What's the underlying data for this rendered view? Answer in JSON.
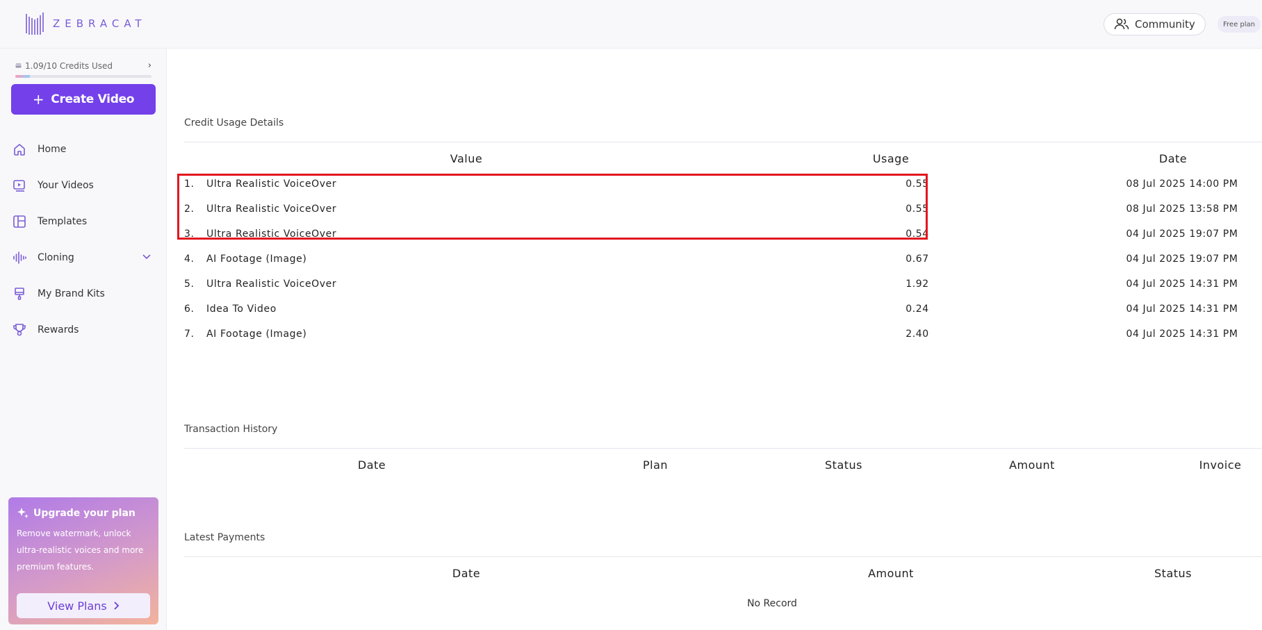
{
  "brand": {
    "name": "ZEBRACAT"
  },
  "header": {
    "community_label": "Community",
    "plan_badge": "Free plan"
  },
  "sidebar": {
    "credits_label": "1.09/10 Credits Used",
    "credits_progress": 0.109,
    "create_label": "Create Video",
    "items": [
      {
        "label": "Home",
        "icon": "home-icon"
      },
      {
        "label": "Your Videos",
        "icon": "video-play-icon"
      },
      {
        "label": "Templates",
        "icon": "templates-icon"
      },
      {
        "label": "Cloning",
        "icon": "waveform-icon"
      },
      {
        "label": "My Brand Kits",
        "icon": "brush-icon"
      },
      {
        "label": "Rewards",
        "icon": "trophy-icon"
      }
    ],
    "upgrade": {
      "title": "Upgrade your plan",
      "description": "Remove watermark, unlock ultra-realistic voices and more premium features.",
      "button": "View Plans"
    }
  },
  "credit_usage": {
    "title": "Credit Usage Details",
    "headers": [
      "Value",
      "Usage",
      "Date"
    ],
    "rows": [
      {
        "num": "1.",
        "value": "Ultra Realistic VoiceOver",
        "usage": "0.55",
        "date": "08 Jul 2025 14:00 PM"
      },
      {
        "num": "2.",
        "value": "Ultra Realistic VoiceOver",
        "usage": "0.55",
        "date": "08 Jul 2025 13:58 PM"
      },
      {
        "num": "3.",
        "value": "Ultra Realistic VoiceOver",
        "usage": "0.54",
        "date": "04 Jul 2025 19:07 PM"
      },
      {
        "num": "4.",
        "value": "AI Footage (Image)",
        "usage": "0.67",
        "date": "04 Jul 2025 19:07 PM"
      },
      {
        "num": "5.",
        "value": "Ultra Realistic VoiceOver",
        "usage": "1.92",
        "date": "04 Jul 2025 14:31 PM"
      },
      {
        "num": "6.",
        "value": "Idea To Video",
        "usage": "0.24",
        "date": "04 Jul 2025 14:31 PM"
      },
      {
        "num": "7.",
        "value": "AI Footage (Image)",
        "usage": "2.40",
        "date": "04 Jul 2025 14:31 PM"
      }
    ]
  },
  "transactions": {
    "title": "Transaction History",
    "headers": [
      "Date",
      "Plan",
      "Status",
      "Amount",
      "Invoice"
    ]
  },
  "payments": {
    "title": "Latest Payments",
    "headers": [
      "Date",
      "Amount",
      "Status"
    ],
    "empty": "No Record"
  },
  "colors": {
    "accent": "#7340ea",
    "highlight": "#e3161f"
  }
}
